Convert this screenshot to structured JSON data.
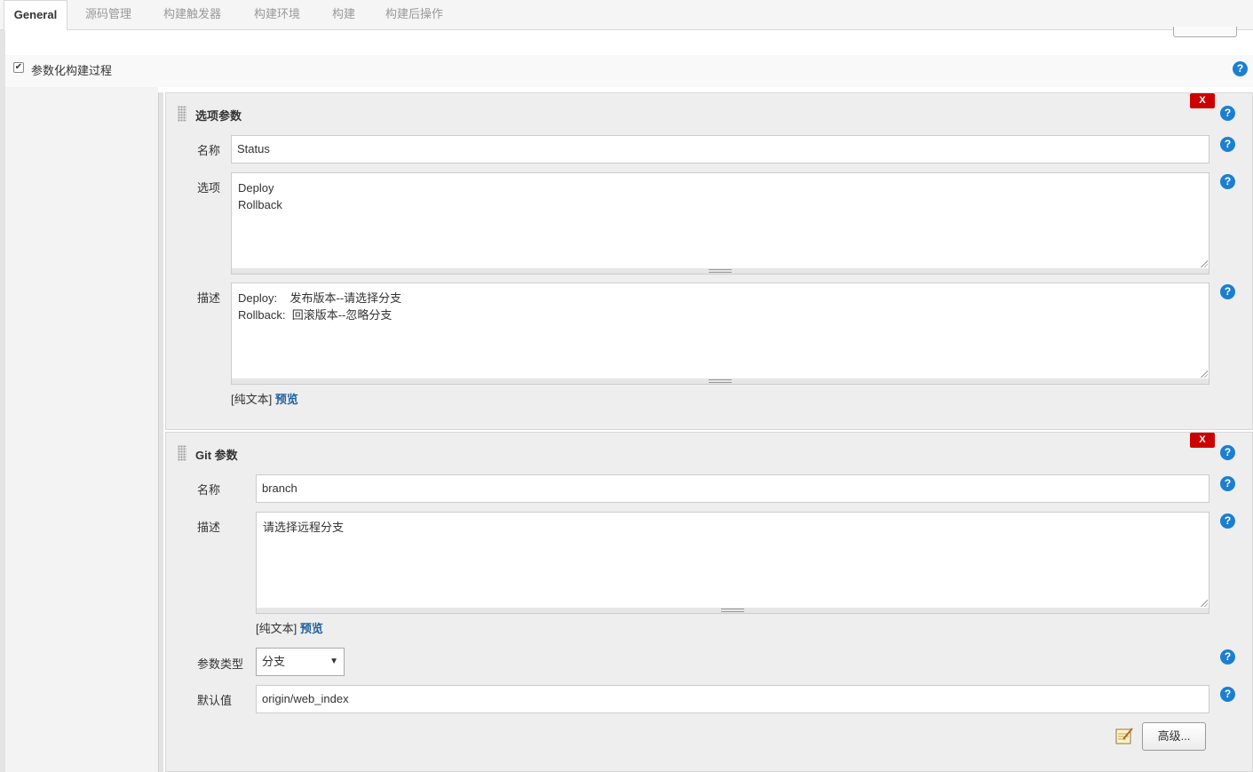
{
  "tabs": [
    {
      "label": "General",
      "active": true
    },
    {
      "label": "源码管理"
    },
    {
      "label": "构建触发器"
    },
    {
      "label": "构建环境"
    },
    {
      "label": "构建"
    },
    {
      "label": "构建后操作"
    }
  ],
  "parameterized": {
    "label": "参数化构建过程",
    "checked": true
  },
  "help_glyph": "?",
  "delete_glyph": "X",
  "choice_param": {
    "title": "选项参数",
    "name_label": "名称",
    "name_value": "Status",
    "choices_label": "选项",
    "choices_value": "Deploy\nRollback",
    "desc_label": "描述",
    "desc_value": "Deploy:    发布版本--请选择分支\nRollback:  回滚版本--忽略分支",
    "format_plain": "[纯文本]",
    "format_preview": "预览"
  },
  "git_param": {
    "title": "Git 参数",
    "name_label": "名称",
    "name_value": "branch",
    "desc_label": "描述",
    "desc_value": "请选择远程分支",
    "format_plain": "[纯文本]",
    "format_preview": "预览",
    "type_label": "参数类型",
    "type_value": "分支",
    "default_label": "默认值",
    "default_value": "origin/web_index",
    "advanced_label": "高级..."
  },
  "colors": {
    "help": "#1b7fd1",
    "delete": "#cc0000",
    "link": "#1f5f9f"
  }
}
